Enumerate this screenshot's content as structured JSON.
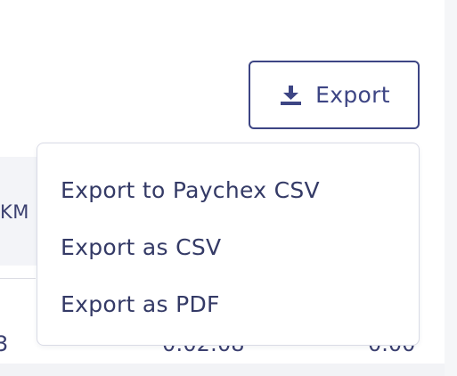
{
  "toolbar": {
    "export_label": "Export",
    "export_icon": "download-icon"
  },
  "export_menu": {
    "items": [
      {
        "label": "Export to Paychex CSV"
      },
      {
        "label": "Export as CSV"
      },
      {
        "label": "Export as PDF"
      }
    ]
  },
  "table": {
    "header_partial": "KM",
    "row": {
      "col_a_partial": "3",
      "col_b_partial": "0:02:08",
      "col_c_partial": "0.00"
    }
  },
  "colors": {
    "accent": "#3d4584",
    "text": "#343a66",
    "border": "#d9dbe6",
    "header_bg": "#f3f4f8"
  }
}
